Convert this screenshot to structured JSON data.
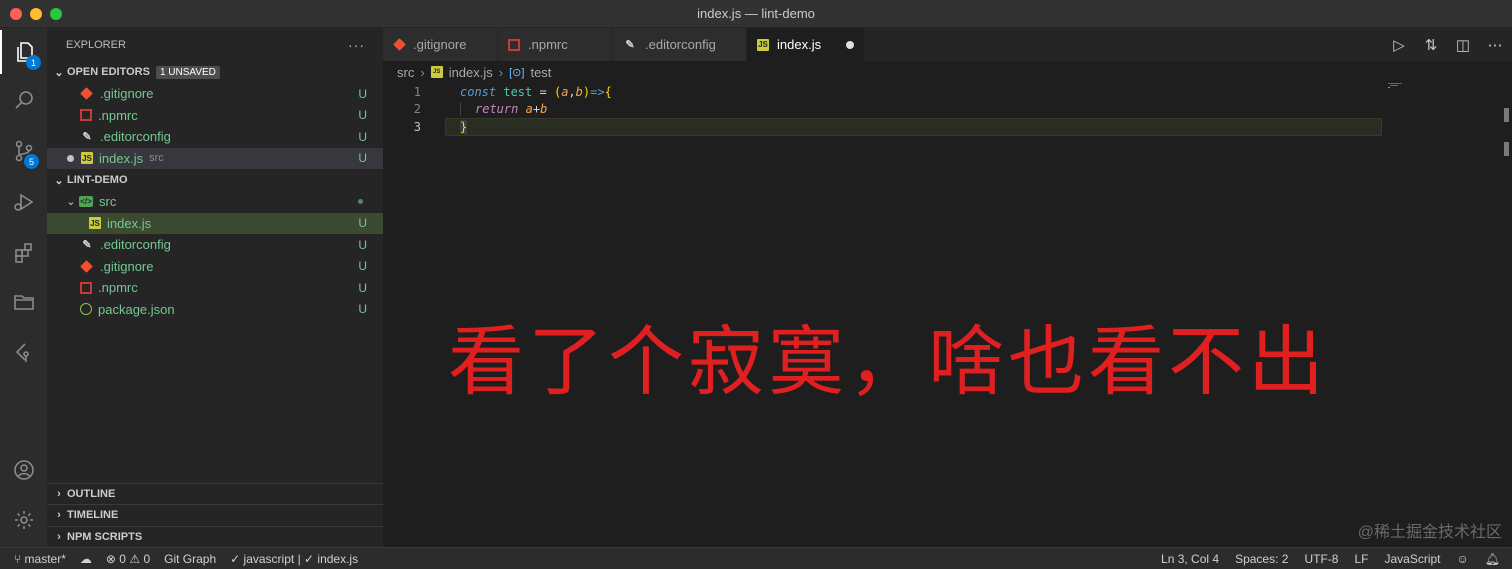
{
  "window": {
    "title": "index.js — lint-demo"
  },
  "activity": {
    "explorer_badge": "1",
    "scm_badge": "5"
  },
  "sidebar": {
    "header": "EXPLORER",
    "more": "···",
    "open_editors": {
      "title": "OPEN EDITORS",
      "badge": "1 UNSAVED",
      "items": [
        {
          "label": ".gitignore",
          "status": "U"
        },
        {
          "label": ".npmrc",
          "status": "U"
        },
        {
          "label": ".editorconfig",
          "status": "U"
        },
        {
          "label": "index.js",
          "hint": "src",
          "status": "U"
        }
      ]
    },
    "project": {
      "title": "LINT-DEMO",
      "folder": "src",
      "items": [
        {
          "label": "index.js",
          "status": "U"
        },
        {
          "label": ".editorconfig",
          "status": "U"
        },
        {
          "label": ".gitignore",
          "status": "U"
        },
        {
          "label": ".npmrc",
          "status": "U"
        },
        {
          "label": "package.json",
          "status": "U"
        }
      ]
    },
    "bottom": [
      "OUTLINE",
      "TIMELINE",
      "NPM SCRIPTS"
    ]
  },
  "tabs": [
    ".gitignore",
    ".npmrc",
    ".editorconfig",
    "index.js"
  ],
  "breadcrumb": {
    "folder": "src",
    "file": "index.js",
    "symbol": "test"
  },
  "code": {
    "line_numbers": [
      "1",
      "2",
      "3"
    ],
    "l1": {
      "kw": "const",
      "name": "test",
      "eq": " = ",
      "p1": "(",
      "a": "a",
      "comma": ",",
      "b": "b",
      "p2": ")",
      "arrow": "=>",
      "brace": "{"
    },
    "l2": {
      "kw": "return",
      "expr_a": "a",
      "plus": "+",
      "expr_b": "b"
    },
    "l3": {
      "brace": "}"
    }
  },
  "overlay": "看了个寂寞，啥也看不出",
  "watermark": "@稀土掘金技术社区",
  "statusbar": {
    "branch": "master*",
    "errors": "0",
    "warnings": "0",
    "git_graph": "Git Graph",
    "eslint": "✓ javascript | ✓ index.js",
    "position": "Ln 3, Col 4",
    "spaces": "Spaces: 2",
    "encoding": "UTF-8",
    "eol": "LF",
    "language": "JavaScript"
  }
}
